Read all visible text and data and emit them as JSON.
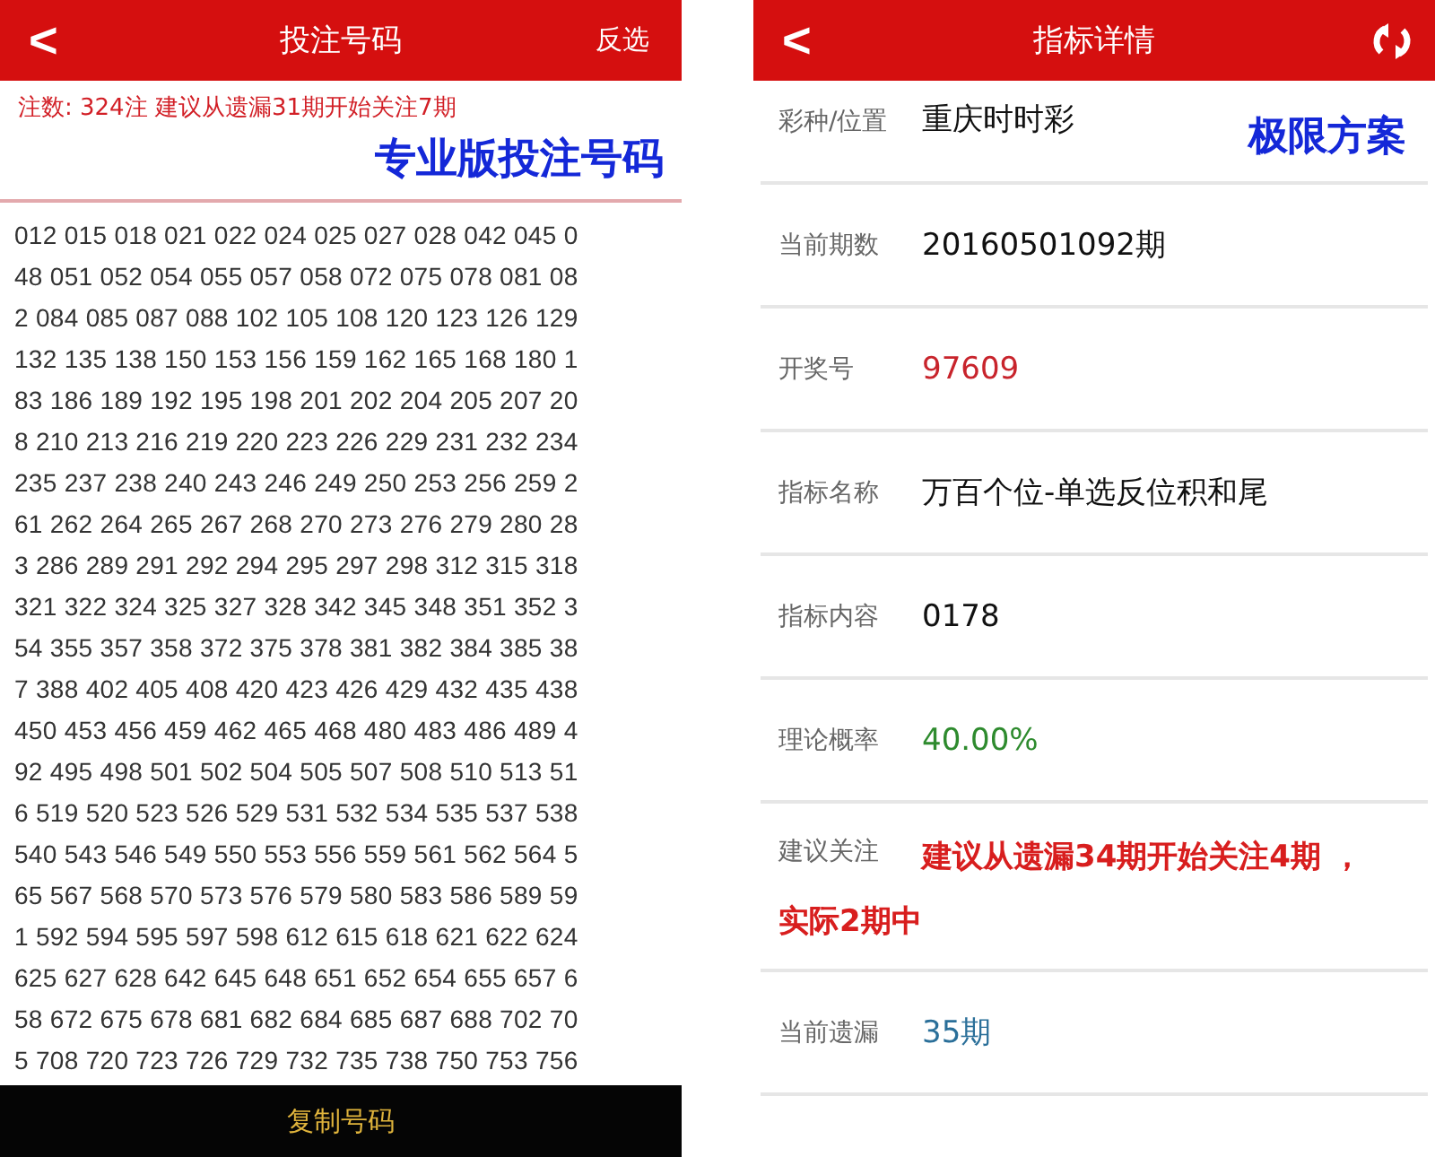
{
  "left_screen": {
    "header": {
      "back": "<",
      "title": "投注号码",
      "action": "反选"
    },
    "summary": "注数: 324注 建议从遗漏31期开始关注7期",
    "banner": "专业版投注号码",
    "number_lines": [
      "012 015 018 021 022 024 025 027 028 042 045 0",
      "48 051 052 054 055 057 058 072 075 078 081 08",
      "2 084 085 087 088 102 105 108 120 123 126 129",
      "132 135 138 150 153 156 159 162 165 168 180 1",
      "83 186 189 192 195 198 201 202 204 205 207 20",
      "8 210 213 216 219 220 223 226 229 231 232 234",
      "235 237 238 240 243 246 249 250 253 256 259 2",
      "61 262 264 265 267 268 270 273 276 279 280 28",
      "3 286 289 291 292 294 295 297 298 312 315 318",
      "321 322 324 325 327 328 342 345 348 351 352 3",
      "54 355 357 358 372 375 378 381 382 384 385 38",
      "7 388 402 405 408 420 423 426 429 432 435 438",
      "450 453 456 459 462 465 468 480 483 486 489 4",
      "92 495 498 501 502 504 505 507 508 510 513 51",
      "6 519 520 523 526 529 531 532 534 535 537 538",
      "540 543 546 549 550 553 556 559 561 562 564 5",
      "65 567 568 570 573 576 579 580 583 586 589 59",
      "1 592 594 595 597 598 612 615 618 621 622 624",
      "625 627 628 642 645 648 651 652 654 655 657 6",
      "58 672 675 678 681 682 684 685 687 688 702 70",
      "5 708 720 723 726 729 732 735 738 750 753 756"
    ],
    "copy_button": "复制号码"
  },
  "right_screen": {
    "header": {
      "back": "<",
      "title": "指标详情"
    },
    "rows": [
      {
        "label": "彩种/位置",
        "value": "重庆时时彩",
        "color": "#111111",
        "badge": "极限方案"
      },
      {
        "label": "当前期数",
        "value": "20160501092期",
        "color": "#111111"
      },
      {
        "label": "开奖号",
        "value": "97609",
        "color": "#c8242c"
      },
      {
        "label": "指标名称",
        "value": "万百个位-单选反位积和尾",
        "color": "#111111"
      },
      {
        "label": "指标内容",
        "value": "0178",
        "color": "#111111"
      },
      {
        "label": "理论概率",
        "value": "40.00%",
        "color": "#2e8b2e"
      },
      {
        "label": "建议关注",
        "value": "建议从遗漏34期开始关注4期 ，",
        "value_line2": "实际2期中",
        "color": "#d81e1e"
      },
      {
        "label": "当前遗漏",
        "value": "35期",
        "color": "#2a6f99"
      }
    ]
  }
}
